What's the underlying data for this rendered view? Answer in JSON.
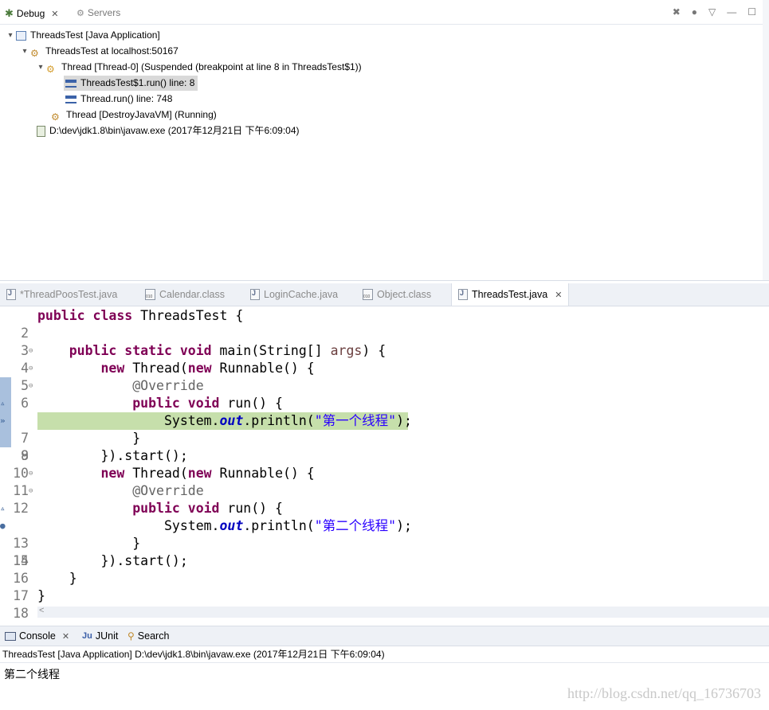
{
  "debug": {
    "tabs": [
      {
        "label": "Debug",
        "icon": "bug-icon"
      },
      {
        "label": "Servers",
        "icon": "servers-icon"
      }
    ],
    "tree": [
      {
        "text": "ThreadsTest [Java Application]",
        "icon": "java-application-icon"
      },
      {
        "text": "ThreadsTest at localhost:50167",
        "icon": "vm-icon"
      },
      {
        "text": "Thread [Thread-0] (Suspended (breakpoint at line 8 in ThreadsTest$1))",
        "icon": "suspended-thread-icon"
      },
      {
        "text": "ThreadsTest$1.run() line: 8",
        "icon": "stack-frame-icon"
      },
      {
        "text": "Thread.run() line: 748",
        "icon": "stack-frame-icon"
      },
      {
        "text": "Thread [DestroyJavaVM] (Running)",
        "icon": "running-thread-icon"
      },
      {
        "text": "D:\\dev\\jdk1.8\\bin\\javaw.exe (2017年12月21日 下午6:09:04)",
        "icon": "process-icon"
      }
    ]
  },
  "editor": {
    "tabs": [
      {
        "label": "*ThreadPoosTest.java",
        "active": false
      },
      {
        "label": "Calendar.class",
        "active": false
      },
      {
        "label": "LoginCache.java",
        "active": false
      },
      {
        "label": "Object.class",
        "active": false
      },
      {
        "label": "ThreadsTest.java",
        "active": true
      }
    ],
    "lines": [
      {
        "num": "2"
      },
      {
        "num": "3"
      },
      {
        "num": "4"
      },
      {
        "num": "5"
      },
      {
        "num": "6"
      },
      {
        "num": "7"
      },
      {
        "num": "8"
      },
      {
        "num": "9"
      },
      {
        "num": "10"
      },
      {
        "num": "11"
      },
      {
        "num": "12"
      },
      {
        "num": "13"
      },
      {
        "num": "14"
      },
      {
        "num": "15"
      },
      {
        "num": "16"
      },
      {
        "num": "17"
      },
      {
        "num": "18"
      }
    ],
    "code": {
      "l2_kw1": "public",
      "l2_kw2": "class",
      "l2_rest": " ThreadsTest {",
      "l4_kw": "public static void",
      "l4_a": " main(String[] ",
      "l4_param": "args",
      "l4_b": ") {",
      "l5_kw1": "new",
      "l5_a": " Thread(",
      "l5_kw2": "new",
      "l5_b": " Runnable() {",
      "l6_ann": "@Override",
      "l7_kw": "public void",
      "l7_rest": " run() {",
      "l8_a": "System.",
      "l8_field": "out",
      "l8_b": ".println(",
      "l8_str": "\"第一个线程\"",
      "l8_c": ");",
      "l9": "}",
      "l10": "}).start();",
      "l11_kw1": "new",
      "l11_a": " Thread(",
      "l11_kw2": "new",
      "l11_b": " Runnable() {",
      "l12_ann": "@Override",
      "l13_kw": "public void",
      "l13_rest": " run() {",
      "l14_a": "System.",
      "l14_field": "out",
      "l14_b": ".println(",
      "l14_str": "\"第二个线程\"",
      "l14_c": ");",
      "l15": "}",
      "l16": "}).start();",
      "l17": "}",
      "l18": "}"
    },
    "hscroll_arrow": "<"
  },
  "console": {
    "tabs": [
      {
        "label": "Console",
        "icon": "console-icon"
      },
      {
        "label": "JUnit",
        "icon": "junit-icon"
      },
      {
        "label": "Search",
        "icon": "search-icon"
      }
    ],
    "description": "ThreadsTest [Java Application] D:\\dev\\jdk1.8\\bin\\javaw.exe (2017年12月21日 下午6:09:04)",
    "output": "第二个线程",
    "watermark": "http://blog.csdn.net/qq_16736703"
  },
  "colors": {
    "keyword": "#7f0055",
    "string": "#2a00ff",
    "field": "#0000c0",
    "annotation": "#646464",
    "current_line": "#c6dfab"
  }
}
